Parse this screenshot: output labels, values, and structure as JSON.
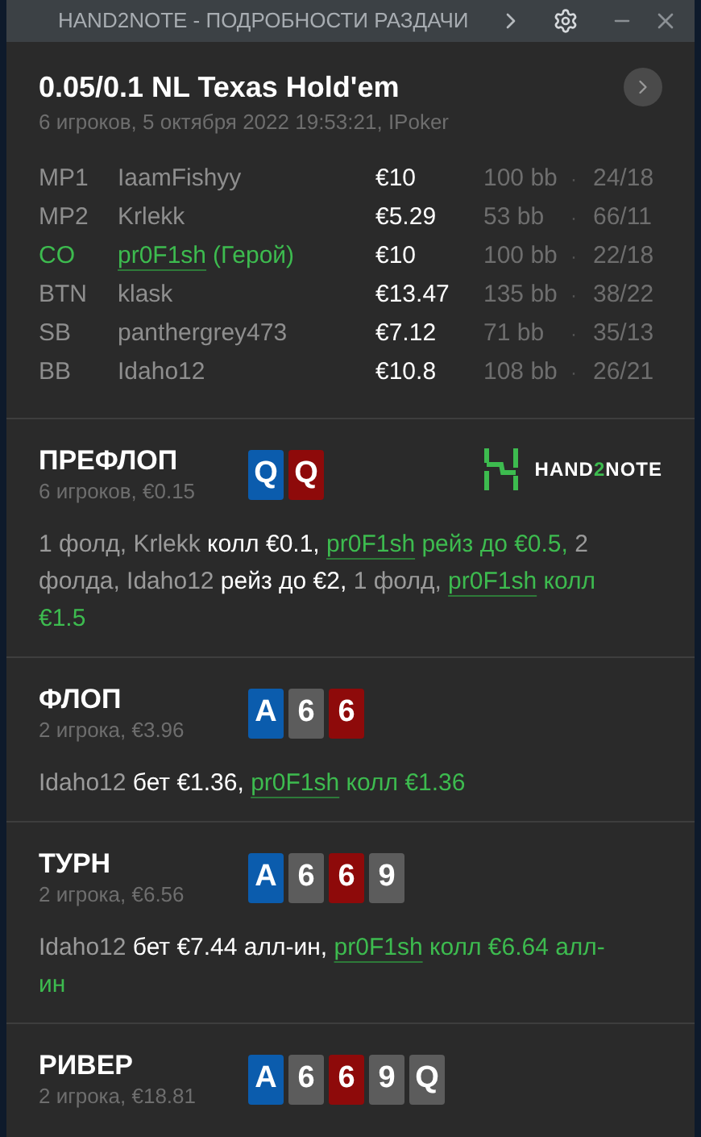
{
  "window": {
    "title": "HAND2NOTE - ПОДРОБНОСТИ РАЗДАЧИ"
  },
  "hand": {
    "title": "0.05/0.1 NL Texas Hold'em",
    "subtitle": "6 игроков, 5 октября 2022 19:53:21, IPoker"
  },
  "players": [
    {
      "position": "MP1",
      "name": "IaamFishyy",
      "hero": false,
      "stack": "€10",
      "bb": "100 bb",
      "separator": "·",
      "stats": "24/18"
    },
    {
      "position": "MP2",
      "name": "Krlekk",
      "hero": false,
      "stack": "€5.29",
      "bb": "53 bb",
      "separator": "·",
      "stats": "66/11"
    },
    {
      "position": "CO",
      "name": "pr0F1sh",
      "hero": true,
      "hero_label": "(Герой)",
      "stack": "€10",
      "bb": "100 bb",
      "separator": "·",
      "stats": "22/18"
    },
    {
      "position": "BTN",
      "name": "klask",
      "hero": false,
      "stack": "€13.47",
      "bb": "135 bb",
      "separator": "·",
      "stats": "38/22"
    },
    {
      "position": "SB",
      "name": "panthergrey473",
      "hero": false,
      "stack": "€7.12",
      "bb": "71 bb",
      "separator": "·",
      "stats": "35/13"
    },
    {
      "position": "BB",
      "name": "Idaho12",
      "hero": false,
      "stack": "€10.8",
      "bb": "108 bb",
      "separator": "·",
      "stats": "26/21"
    }
  ],
  "streets": [
    {
      "name": "ПРЕФЛОП",
      "info": "6 игроков, €0.15",
      "logo": {
        "parts": [
          "HAND",
          "2",
          "NOTE"
        ]
      },
      "cards": [
        {
          "rank": "Q",
          "color": "#0b5cad"
        },
        {
          "rank": "Q",
          "color": "#8e0a0a"
        }
      ],
      "actions": [
        {
          "kind": "muted",
          "text": "1 фолд, Krlekk"
        },
        {
          "kind": "action",
          "text": " колл €0.1, "
        },
        {
          "kind": "hero",
          "text": "pr0F1sh"
        },
        {
          "kind": "hero_action",
          "text": " рейз до €0.5, "
        },
        {
          "kind": "muted",
          "text": "2 фолда, Idaho12"
        },
        {
          "kind": "action",
          "text": " рейз до €2, "
        },
        {
          "kind": "muted",
          "text": "1 фолд, "
        },
        {
          "kind": "hero",
          "text": "pr0F1sh"
        },
        {
          "kind": "hero_action",
          "text": " колл €1.5"
        }
      ]
    },
    {
      "name": "ФЛОП",
      "info": "2 игрока, €3.96",
      "cards": [
        {
          "rank": "A",
          "color": "#0b5cad"
        },
        {
          "rank": "6",
          "color": "#5c5c5c"
        },
        {
          "rank": "6",
          "color": "#8e0a0a"
        }
      ],
      "actions": [
        {
          "kind": "muted",
          "text": "Idaho12"
        },
        {
          "kind": "action",
          "text": " бет €1.36, "
        },
        {
          "kind": "hero",
          "text": "pr0F1sh"
        },
        {
          "kind": "hero_action",
          "text": " колл €1.36"
        }
      ]
    },
    {
      "name": "ТУРН",
      "info": "2 игрока, €6.56",
      "cards": [
        {
          "rank": "A",
          "color": "#0b5cad"
        },
        {
          "rank": "6",
          "color": "#5c5c5c"
        },
        {
          "rank": "6",
          "color": "#8e0a0a"
        },
        {
          "rank": "9",
          "color": "#5c5c5c"
        }
      ],
      "actions": [
        {
          "kind": "muted",
          "text": "Idaho12"
        },
        {
          "kind": "action",
          "text": " бет €7.44 алл-ин, "
        },
        {
          "kind": "hero",
          "text": "pr0F1sh"
        },
        {
          "kind": "hero_action",
          "text": " колл €6.64 алл-ин"
        }
      ]
    },
    {
      "name": "РИВЕР",
      "info": "2 игрока, €18.81",
      "cards": [
        {
          "rank": "A",
          "color": "#0b5cad"
        },
        {
          "rank": "6",
          "color": "#5c5c5c"
        },
        {
          "rank": "6",
          "color": "#8e0a0a"
        },
        {
          "rank": "9",
          "color": "#5c5c5c"
        },
        {
          "rank": "Q",
          "color": "#5c5c5c"
        }
      ]
    }
  ]
}
